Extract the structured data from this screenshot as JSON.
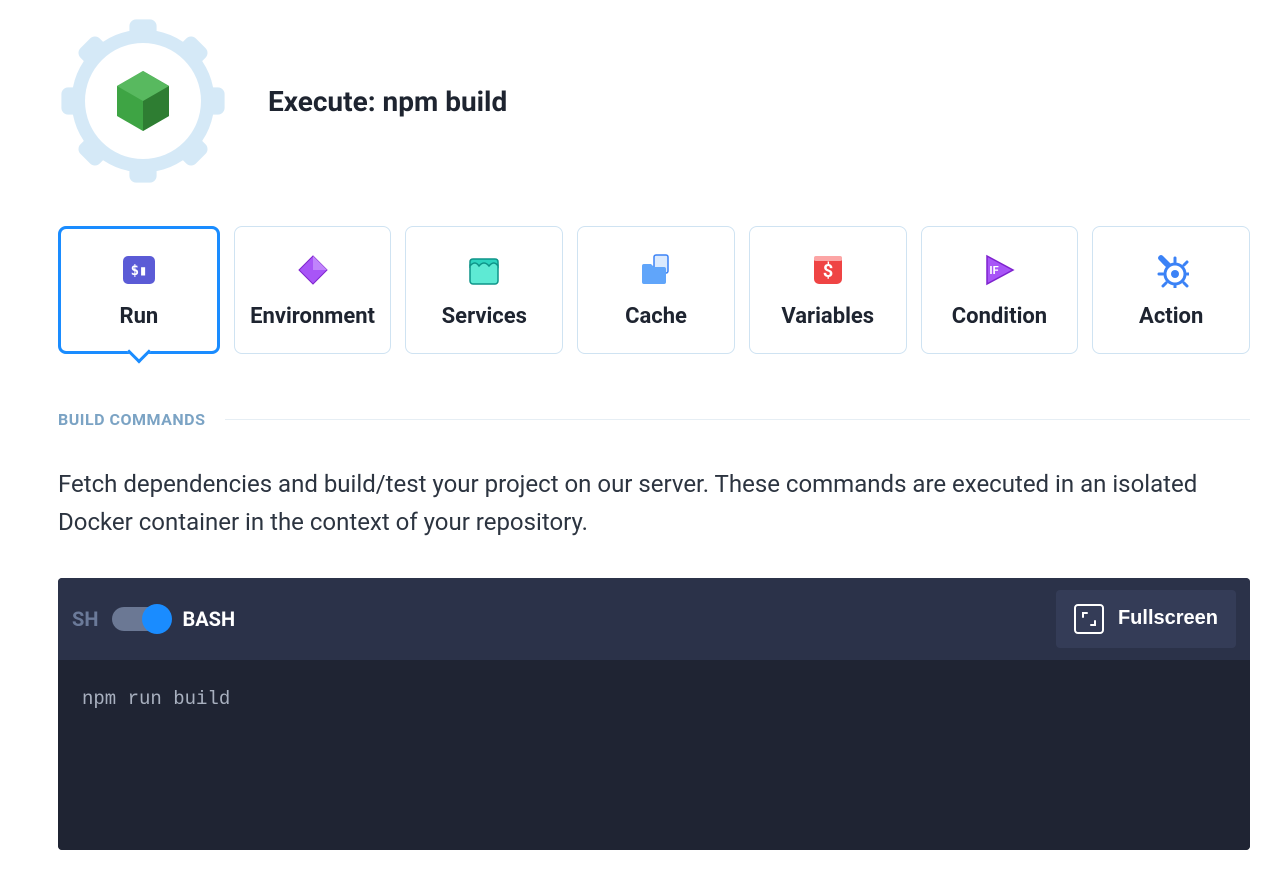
{
  "header": {
    "title": "Execute: npm build"
  },
  "tabs": [
    {
      "label": "Run",
      "icon": "terminal-icon",
      "active": true
    },
    {
      "label": "Environment",
      "icon": "diamond-icon",
      "active": false
    },
    {
      "label": "Services",
      "icon": "box-icon",
      "active": false
    },
    {
      "label": "Cache",
      "icon": "folder-icon",
      "active": false
    },
    {
      "label": "Variables",
      "icon": "dollar-icon",
      "active": false
    },
    {
      "label": "Condition",
      "icon": "if-play-icon",
      "active": false
    },
    {
      "label": "Action",
      "icon": "wrench-gear-icon",
      "active": false
    }
  ],
  "section": {
    "title": "BUILD COMMANDS",
    "description": "Fetch dependencies and build/test your project on our server. These commands are executed in an isolated Docker container in the context of your repository."
  },
  "editor": {
    "shell_left": "SH",
    "shell_right": "BASH",
    "fullscreen_label": "Fullscreen",
    "content": "npm run build"
  }
}
